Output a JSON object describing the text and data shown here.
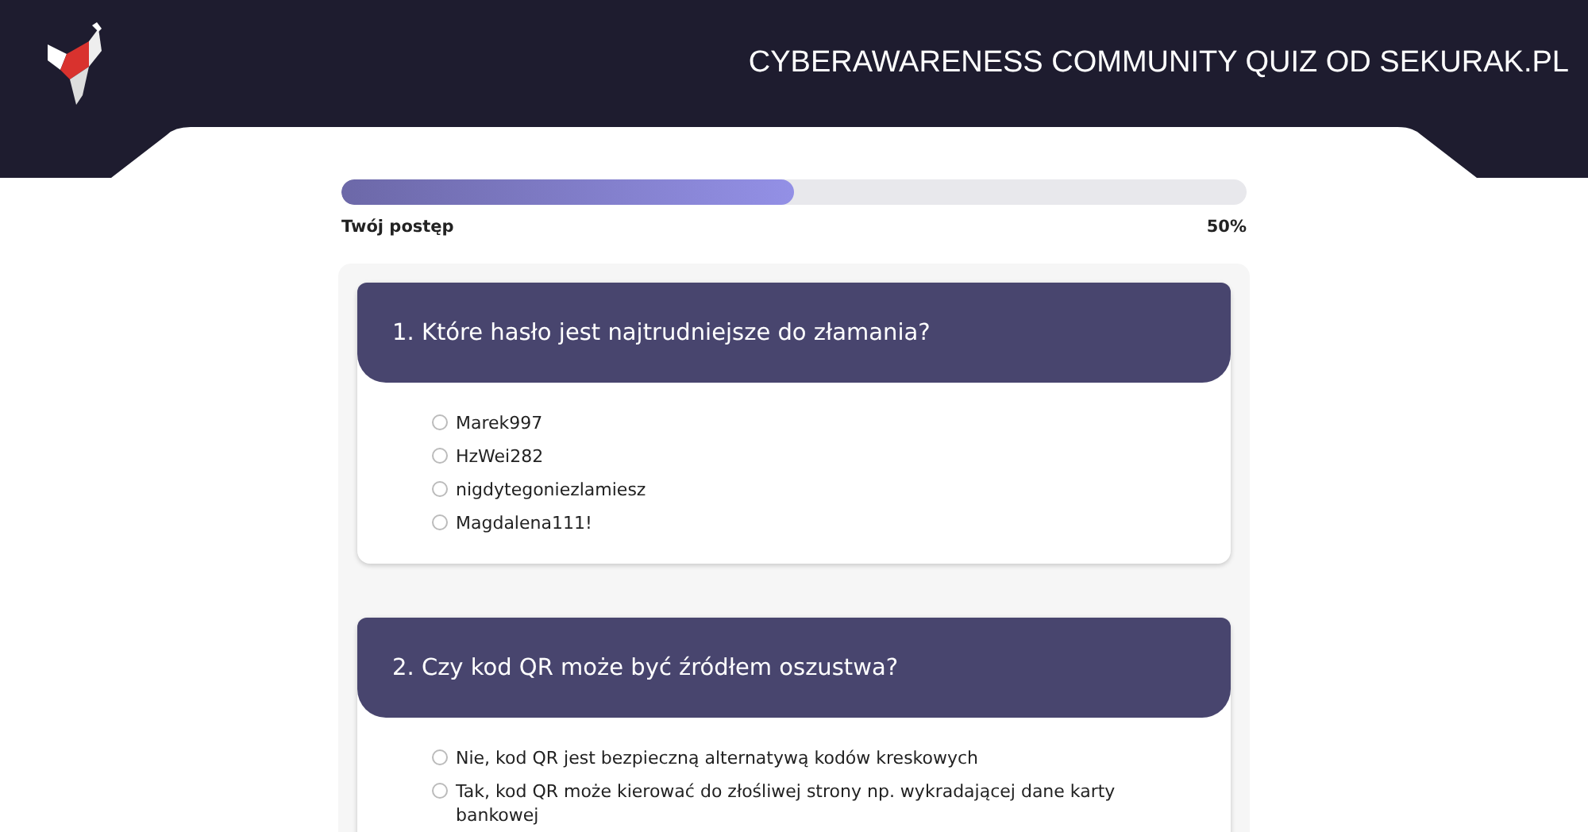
{
  "header": {
    "title": "CYBERAWARENESS COMMUNITY QUIZ OD SEKURAK.PL"
  },
  "progress": {
    "level": 0.5,
    "label": "Twój postęp",
    "reading": "50%"
  },
  "questions": [
    {
      "title": "1. Które hasło jest najtrudniejsze do złamania?",
      "options": [
        {
          "label": "Marek997",
          "selected": false
        },
        {
          "label": "HzWei282",
          "selected": false
        },
        {
          "label": "nigdytegoniezlamiesz",
          "selected": false
        },
        {
          "label": "Magdalena111!",
          "selected": false
        }
      ]
    },
    {
      "title": "2. Czy kod QR może być źródłem oszustwa?",
      "options": [
        {
          "label": "Nie, kod QR jest bezpieczną alternatywą kodów kreskowych",
          "selected": false
        },
        {
          "label": "Tak, kod QR może kierować do złośliwej strony np. wykradającej dane karty bankowej",
          "selected": false
        }
      ]
    }
  ]
}
